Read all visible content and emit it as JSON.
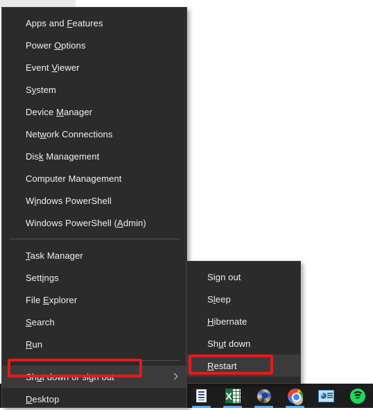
{
  "desktop": {
    "background_color": "#ffffff",
    "top_strip_color": "#e9e9e9"
  },
  "power_user_menu": {
    "name": "Power User Menu",
    "background_color": "#2b2b2b",
    "text_color": "#f0f0f0",
    "items": [
      {
        "label": "Apps and Features",
        "accel_before": "Apps and ",
        "accel": "F",
        "accel_after": "eatures",
        "submenu": false,
        "hovered": false
      },
      {
        "label": "Power Options",
        "accel_before": "Power ",
        "accel": "O",
        "accel_after": "ptions",
        "submenu": false,
        "hovered": false
      },
      {
        "label": "Event Viewer",
        "accel_before": "Event ",
        "accel": "V",
        "accel_after": "iewer",
        "submenu": false,
        "hovered": false
      },
      {
        "label": "System",
        "accel_before": "S",
        "accel": "y",
        "accel_after": "stem",
        "submenu": false,
        "hovered": false
      },
      {
        "label": "Device Manager",
        "accel_before": "Device ",
        "accel": "M",
        "accel_after": "anager",
        "submenu": false,
        "hovered": false
      },
      {
        "label": "Network Connections",
        "accel_before": "Net",
        "accel": "w",
        "accel_after": "ork Connections",
        "submenu": false,
        "hovered": false
      },
      {
        "label": "Disk Management",
        "accel_before": "Dis",
        "accel": "k",
        "accel_after": " Management",
        "submenu": false,
        "hovered": false
      },
      {
        "label": "Computer Management",
        "accel_before": "Computer Mana",
        "accel": "g",
        "accel_after": "ement",
        "submenu": false,
        "hovered": false
      },
      {
        "label": "Windows PowerShell",
        "accel_before": "W",
        "accel": "i",
        "accel_after": "ndows PowerShell",
        "submenu": false,
        "hovered": false
      },
      {
        "label": "Windows PowerShell (Admin)",
        "accel_before": "Windows PowerShell (",
        "accel": "A",
        "accel_after": "dmin)",
        "submenu": false,
        "hovered": false
      },
      {
        "separator": true
      },
      {
        "label": "Task Manager",
        "accel_before": "",
        "accel": "T",
        "accel_after": "ask Manager",
        "submenu": false,
        "hovered": false
      },
      {
        "label": "Settings",
        "accel_before": "Sett",
        "accel": "i",
        "accel_after": "ngs",
        "submenu": false,
        "hovered": false
      },
      {
        "label": "File Explorer",
        "accel_before": "File ",
        "accel": "E",
        "accel_after": "xplorer",
        "submenu": false,
        "hovered": false
      },
      {
        "label": "Search",
        "accel_before": "",
        "accel": "S",
        "accel_after": "earch",
        "submenu": false,
        "hovered": false
      },
      {
        "label": "Run",
        "accel_before": "",
        "accel": "R",
        "accel_after": "un",
        "submenu": false,
        "hovered": false
      },
      {
        "separator": true
      },
      {
        "label": "Shut down or sign out",
        "accel_before": "Sh",
        "accel": "u",
        "accel_after": "t down or sign out",
        "submenu": true,
        "hovered": true
      },
      {
        "label": "Desktop",
        "accel_before": "",
        "accel": "D",
        "accel_after": "esktop",
        "submenu": false,
        "hovered": false
      }
    ]
  },
  "shutdown_submenu": {
    "name": "Shut down or sign out",
    "background_color": "#2b2b2b",
    "items": [
      {
        "label": "Sign out",
        "accel_before": "Si",
        "accel": "g",
        "accel_after": "n out",
        "hovered": false
      },
      {
        "label": "Sleep",
        "accel_before": "S",
        "accel": "l",
        "accel_after": "eep",
        "hovered": false
      },
      {
        "label": "Hibernate",
        "accel_before": "",
        "accel": "H",
        "accel_after": "ibernate",
        "hovered": false
      },
      {
        "label": "Shut down",
        "accel_before": "Sh",
        "accel": "u",
        "accel_after": "t down",
        "hovered": false
      },
      {
        "label": "Restart",
        "accel_before": "",
        "accel": "R",
        "accel_after": "estart",
        "hovered": true
      }
    ]
  },
  "annotations": {
    "color": "#e8191b",
    "boxes": [
      {
        "target": "Shut down or sign out"
      },
      {
        "target": "Restart"
      }
    ]
  },
  "taskbar": {
    "background_color": "#1d1d1d",
    "items": [
      {
        "name": "sticky-notes",
        "icon": "notes-icon",
        "active": true
      },
      {
        "name": "Microsoft Excel",
        "icon": "excel-icon",
        "active": true
      },
      {
        "name": "Photo Viewer",
        "icon": "photos-icon",
        "active": true
      },
      {
        "name": "Google Chrome",
        "icon": "chrome-icon",
        "active": true
      },
      {
        "name": "Microsoft PowerPoint",
        "icon": "powerpoint-icon",
        "active": false
      },
      {
        "name": "Spotify",
        "icon": "spotify-icon",
        "active": false
      }
    ]
  }
}
